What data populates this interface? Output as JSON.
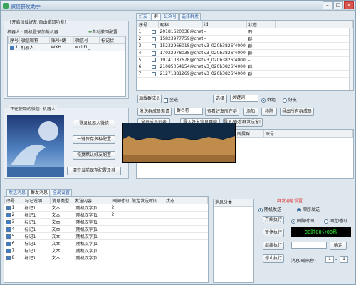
{
  "window": {
    "title": "微信群发助手",
    "min": "–",
    "max": "□",
    "close": "×"
  },
  "left_group": {
    "title": "[开启加载好友/自由撤回功能]",
    "robot_label": "机器人 : 随机登录加载机器",
    "auto_reply": "自动撤回配置",
    "columns": [
      "序号",
      "微信昵称",
      "账号(便",
      "微信号",
      "标记状"
    ],
    "rows": [
      [
        "1",
        "机器人",
        "WXH",
        "wxid1_",
        ""
      ]
    ]
  },
  "robot_group": {
    "title": "正在使用的微信: 机器人",
    "buttons": [
      "登录机器人微信",
      "一键保存多种配置",
      "恢复默认好友配置",
      "清空当前保存配置及其"
    ]
  },
  "right_tabs": [
    "好友",
    "群",
    "公众号",
    "选择群发"
  ],
  "contacts": {
    "columns": [
      "序号",
      "",
      "昵称",
      "id",
      "状态"
    ],
    "rows": [
      [
        "1",
        "石",
        "20181620038@chatroom",
        "–"
      ],
      [
        "2",
        "群",
        "15823977759@chatroom",
        "–"
      ],
      [
        "3",
        "群",
        "15232966018@chatroom",
        "v3_020b3826f4000..."
      ],
      [
        "4",
        "群",
        "17022978038@chatroom",
        "v3_020b3826f4000..."
      ],
      [
        "5",
        "–",
        "19741037678@chatroom",
        "v3_020b3826f4000..."
      ],
      [
        "6",
        "群",
        "21085054154@chatroom",
        "v3_020b3826f4000..."
      ],
      [
        "7",
        "群",
        "21271881269@chatroom",
        "v3_020b3826f4000..."
      ]
    ]
  },
  "filter_row": {
    "refresh": "加载群成员",
    "all_label": "全选",
    "select": "选择",
    "input_placeholder": "关键词",
    "radio_group": "群组",
    "radio_friend": "好友"
  },
  "group_actions": {
    "invite": "发送群成员邀请",
    "group_name": "群名称",
    "send_selected": "查看好友所在群",
    "add": "添加",
    "delete": "移除",
    "export": "导出所有群成员",
    "all_members": "全员成员列表",
    "save": "导入好友信息群聊",
    "clear": "导入/查看群发送窗口"
  },
  "member_table": {
    "columns": [
      "",
      "",
      "",
      "",
      "所属群",
      "账号"
    ]
  },
  "bottom_tabs": [
    "发送消息",
    "群发消息",
    "全局设置"
  ],
  "messages": {
    "columns": [
      "序号",
      "标记说明",
      "消息类型",
      "发送内容",
      "间隔时间",
      "限定发送时间",
      "状态"
    ],
    "rows": [
      [
        "1",
        "标记1",
        "文本",
        "[随机汉字]1",
        "2",
        "",
        ""
      ],
      [
        "2",
        "标记1",
        "文本",
        "[随机汉字]1",
        "2",
        "",
        ""
      ],
      [
        "3",
        "标记1",
        "文本",
        "[随机汉字]1",
        "",
        "",
        ""
      ],
      [
        "4",
        "标记1",
        "文本",
        "[随机汉字]1",
        "",
        "",
        ""
      ],
      [
        "5",
        "标记1",
        "文本",
        "[随机汉字]1",
        "",
        "",
        ""
      ],
      [
        "6",
        "标记1",
        "文本",
        "[随机汉字]1",
        "",
        "",
        ""
      ],
      [
        "7",
        "标记1",
        "文本",
        "[随机汉字]1",
        "",
        "",
        ""
      ],
      [
        "8",
        "标记1",
        "文本",
        "[随机汉字]1",
        "",
        "",
        ""
      ]
    ]
  },
  "queue": {
    "header": "消息分类"
  },
  "control": {
    "title": "群发消息设置",
    "radio_random": "随机发送",
    "radio_seq": "顺序发送",
    "start": "开始执行",
    "pause": "暂停执行",
    "resume": "继续执行",
    "stop": "停止执行",
    "radio_interval": "间隔时间",
    "radio_fixed": "固定时间",
    "timer": "00时00分00秒",
    "time_input": "",
    "confirm": "确定",
    "interval_label": "消息间隔(秒)",
    "interval_from": "1",
    "interval_to": "1"
  }
}
